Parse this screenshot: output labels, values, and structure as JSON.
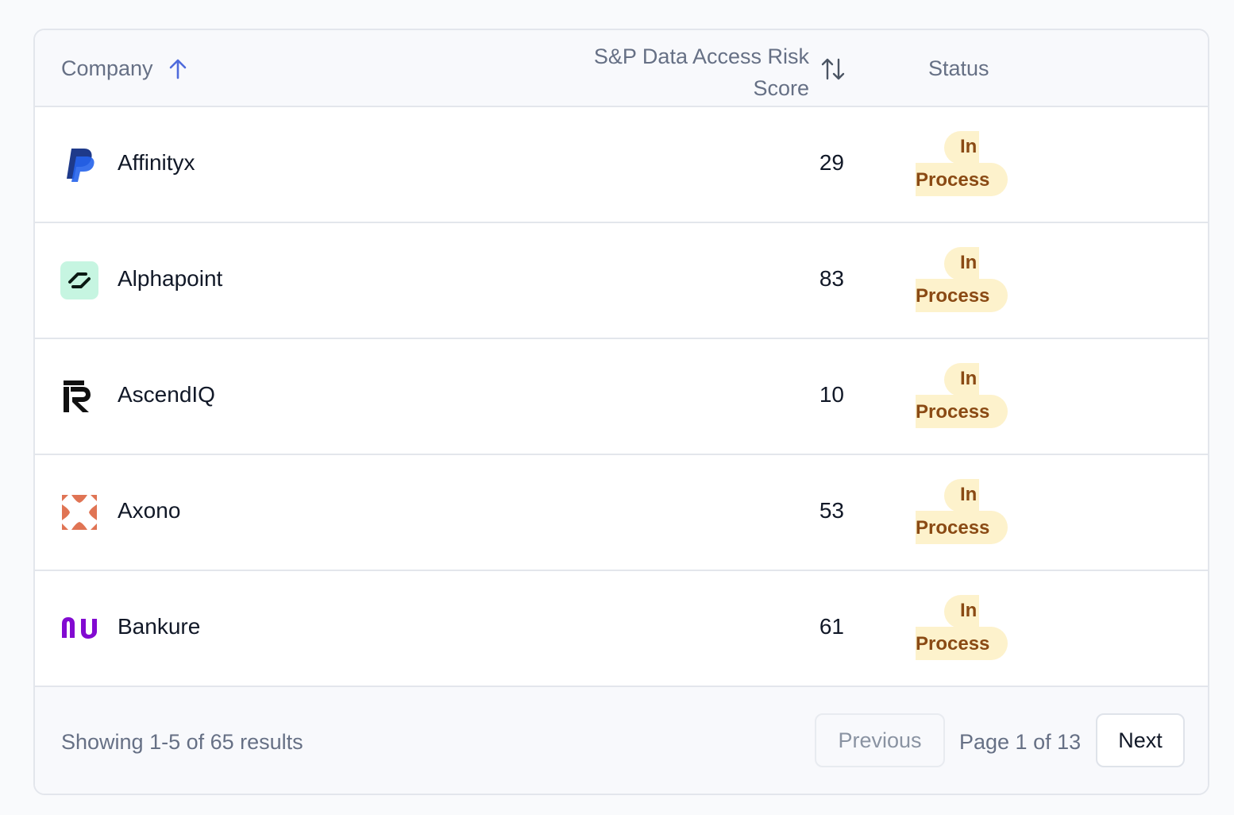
{
  "table": {
    "headers": {
      "company": "Company",
      "score": "S&P Data Access Risk Score",
      "status": "Status"
    },
    "rows": [
      {
        "company": "Affinityx",
        "score": "29",
        "status_line1": "In",
        "status_line2": "Process",
        "logo": "paypal-logo"
      },
      {
        "company": "Alphapoint",
        "score": "83",
        "status_line1": "In",
        "status_line2": "Process",
        "logo": "alphapoint-logo"
      },
      {
        "company": "AscendIQ",
        "score": "10",
        "status_line1": "In",
        "status_line2": "Process",
        "logo": "r-logo"
      },
      {
        "company": "Axono",
        "score": "53",
        "status_line1": "In",
        "status_line2": "Process",
        "logo": "axono-logo"
      },
      {
        "company": "Bankure",
        "score": "61",
        "status_line1": "In",
        "status_line2": "Process",
        "logo": "nu-logo"
      }
    ]
  },
  "footer": {
    "showing": "Showing 1-5 of 65 results",
    "previous": "Previous",
    "page_info": "Page 1 of 13",
    "next": "Next"
  },
  "colors": {
    "accent": "#4f6bdc",
    "badge_bg": "#fdf2cc",
    "badge_text": "#8a4a14"
  }
}
